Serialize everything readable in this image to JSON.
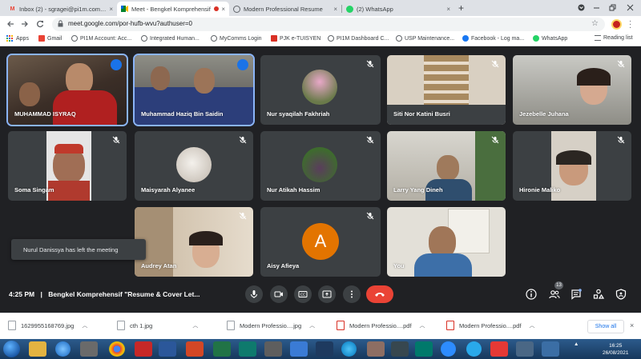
{
  "browser": {
    "tabs": [
      {
        "title": "Inbox (2) - sgragei@pi1m.com.my",
        "icon": "gmail-icon",
        "active": false
      },
      {
        "title": "Meet - Bengkel Komprehensif",
        "icon": "meet-icon",
        "active": true
      },
      {
        "title": "Modern Professional Resume",
        "icon": "globe-icon",
        "active": false
      },
      {
        "title": "(2) WhatsApp",
        "icon": "whatsapp-icon",
        "active": false
      }
    ],
    "new_tab": "+",
    "close_glyph": "×",
    "url": "meet.google.com/por-hufb-wvu?authuser=0"
  },
  "bookmarks": [
    {
      "label": "Apps",
      "color": "#5f6368"
    },
    {
      "label": "Gmail",
      "color": "#ea4335"
    },
    {
      "label": "PI1M Account: Acc...",
      "color": "#5f6368"
    },
    {
      "label": "Integrated Human...",
      "color": "#5f6368"
    },
    {
      "label": "MyComms Login",
      "color": "#5f6368"
    },
    {
      "label": "PJK e-TUISYEN",
      "color": "#d93025"
    },
    {
      "label": "PI1M Dashboard C...",
      "color": "#5f6368"
    },
    {
      "label": "USP Maintenance...",
      "color": "#5f6368"
    },
    {
      "label": "Facebook - Log ma...",
      "color": "#1877f2"
    },
    {
      "label": "WhatsApp",
      "color": "#25d366"
    }
  ],
  "reading_list": "Reading list",
  "participants": [
    {
      "name": "MUHAMMAD ISYRAQ",
      "muted": false,
      "speaking": true
    },
    {
      "name": "Muhammad Haziq Bin Saidin",
      "muted": false,
      "speaking": true
    },
    {
      "name": "Nur syaqilah Fakhriah",
      "muted": true,
      "speaking": false
    },
    {
      "name": "Siti Nor Katini Busri",
      "muted": true,
      "speaking": false
    },
    {
      "name": "Jezebelle Juhana",
      "muted": true,
      "speaking": false
    },
    {
      "name": "Soma Singam",
      "muted": true,
      "speaking": false
    },
    {
      "name": "Maisyarah Alyanee",
      "muted": true,
      "speaking": false
    },
    {
      "name": "Nur Atikah Hassim",
      "muted": true,
      "speaking": false
    },
    {
      "name": "Larry Yang Dineh",
      "muted": true,
      "speaking": false
    },
    {
      "name": "Hironie Maliko",
      "muted": true,
      "speaking": false
    },
    {
      "name": "Audrey Atan",
      "muted": true,
      "speaking": false
    },
    {
      "name": "Aisy Afieya",
      "muted": true,
      "speaking": false,
      "avatar_letter": "A",
      "avatar_color": "#e37400"
    },
    {
      "name": "You",
      "muted": false,
      "speaking": false
    }
  ],
  "notification": "Nurul Danissya has left the meeting",
  "meeting": {
    "time": "4:25 PM",
    "separator": "|",
    "title": "Bengkel Komprehensif \"Resume & Cover Let...",
    "participant_count": "13"
  },
  "downloads": [
    {
      "name": "1629955168769.jpg",
      "type": "image"
    },
    {
      "name": "cth 1.jpg",
      "type": "image"
    },
    {
      "name": "Modern Professio....jpg",
      "type": "image"
    },
    {
      "name": "Modern Professio....pdf",
      "type": "pdf"
    },
    {
      "name": "Modern Professio....pdf",
      "type": "pdf"
    }
  ],
  "show_all": "Show all",
  "taskbar": {
    "time": "16:25",
    "date": "26/08/2021"
  },
  "colors": {
    "meet_bg": "#202124",
    "tile_bg": "#3c4043",
    "hangup": "#ea4335",
    "speaking_blue": "#1a73e8"
  }
}
